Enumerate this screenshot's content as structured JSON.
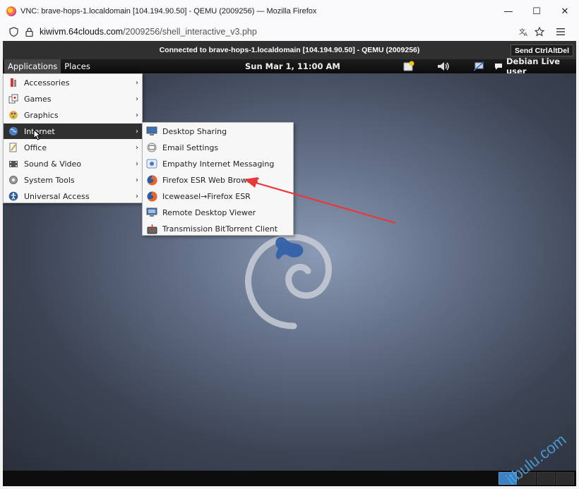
{
  "browser": {
    "window_title": "VNC: brave-hops-1.localdomain [104.194.90.50] - QEMU (2009256) — Mozilla Firefox",
    "url_domain": "kiwivm.64clouds.com",
    "url_path": "/2009256/shell_interactive_v3.php",
    "window_buttons": {
      "minimize": "—",
      "maximize": "☐",
      "close": "✕"
    }
  },
  "vnc": {
    "status": "Connected to brave-hops-1.localdomain [104.194.90.50] - QEMU (2009256)",
    "send_ctrl_alt_del": "Send CtrlAltDel"
  },
  "panel": {
    "applications": "Applications",
    "places": "Places",
    "clock": "Sun Mar  1, 11:00 AM",
    "user": "Debian Live user"
  },
  "apps_menu": {
    "items": [
      {
        "label": "Accessories",
        "icon": "accessories-icon"
      },
      {
        "label": "Games",
        "icon": "games-icon"
      },
      {
        "label": "Graphics",
        "icon": "graphics-icon"
      },
      {
        "label": "Internet",
        "icon": "globe-icon",
        "selected": true
      },
      {
        "label": "Office",
        "icon": "office-icon"
      },
      {
        "label": "Sound & Video",
        "icon": "sound-video-icon"
      },
      {
        "label": "System Tools",
        "icon": "gear-icon"
      },
      {
        "label": "Universal Access",
        "icon": "accessibility-icon"
      }
    ]
  },
  "internet_menu": {
    "items": [
      {
        "label": "Desktop Sharing",
        "icon": "desktop-sharing-icon"
      },
      {
        "label": "Email Settings",
        "icon": "email-settings-icon"
      },
      {
        "label": "Empathy Internet Messaging",
        "icon": "empathy-icon"
      },
      {
        "label": "Firefox ESR Web Browser",
        "icon": "firefox-icon"
      },
      {
        "label": "Iceweasel→Firefox ESR",
        "icon": "firefox-icon"
      },
      {
        "label": "Remote Desktop Viewer",
        "icon": "remote-desktop-icon"
      },
      {
        "label": "Transmission BitTorrent Client",
        "icon": "transmission-icon"
      }
    ]
  },
  "watermark": "itbulu.com",
  "colors": {
    "menu_selected": "#303030",
    "annotation_arrow": "#e8393a",
    "watermark": "#4aa8e8"
  }
}
